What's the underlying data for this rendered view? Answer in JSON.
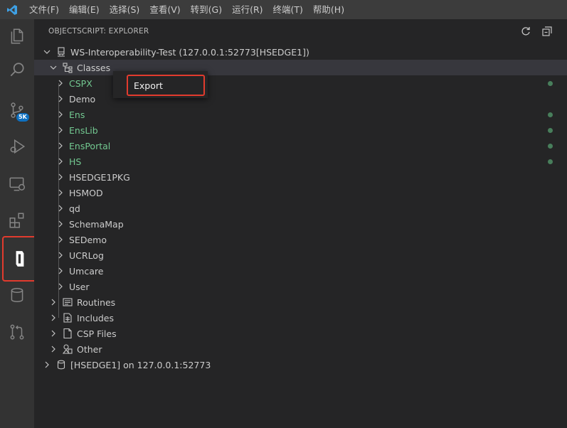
{
  "menubar": {
    "logo": "vscode-logo-icon",
    "items": [
      "文件(F)",
      "编辑(E)",
      "选择(S)",
      "查看(V)",
      "转到(G)",
      "运行(R)",
      "终端(T)",
      "帮助(H)"
    ]
  },
  "activitybar": {
    "items": [
      "explorer-icon",
      "search-icon",
      "source-control-icon",
      "run-debug-icon",
      "remote-explorer-icon",
      "extensions-icon",
      "objectscript-icon",
      "database-icon",
      "pull-request-icon"
    ],
    "source_control_badge": "5K"
  },
  "panel": {
    "title": "OBJECTSCRIPT: EXPLORER",
    "actions": [
      "refresh-icon",
      "collapse-all-icon"
    ]
  },
  "tree": {
    "workspace": "WS-Interoperability-Test (127.0.0.1:52773[HSEDGE1])",
    "classes_label": "Classes",
    "packages": [
      {
        "name": "CSPX",
        "modified": true
      },
      {
        "name": "Demo",
        "modified": false
      },
      {
        "name": "Ens",
        "modified": true
      },
      {
        "name": "EnsLib",
        "modified": true
      },
      {
        "name": "EnsPortal",
        "modified": true
      },
      {
        "name": "HS",
        "modified": true
      },
      {
        "name": "HSEDGE1PKG",
        "modified": false
      },
      {
        "name": "HSMOD",
        "modified": false
      },
      {
        "name": "qd",
        "modified": false
      },
      {
        "name": "SchemaMap",
        "modified": false
      },
      {
        "name": "SEDemo",
        "modified": false
      },
      {
        "name": "UCRLog",
        "modified": false
      },
      {
        "name": "Umcare",
        "modified": false
      },
      {
        "name": "User",
        "modified": false
      }
    ],
    "folders": [
      {
        "label": "Routines",
        "icon": "routines-icon"
      },
      {
        "label": "Includes",
        "icon": "includes-icon"
      },
      {
        "label": "CSP Files",
        "icon": "csp-file-icon"
      },
      {
        "label": "Other",
        "icon": "other-icon"
      }
    ],
    "server_label": "[HSEDGE1] on 127.0.0.1:52773"
  },
  "context_menu": {
    "items": [
      "Export"
    ]
  },
  "colors": {
    "accent_highlight": "#e23b2e",
    "modified_text": "#73c991",
    "modified_dot": "#487e5b"
  }
}
